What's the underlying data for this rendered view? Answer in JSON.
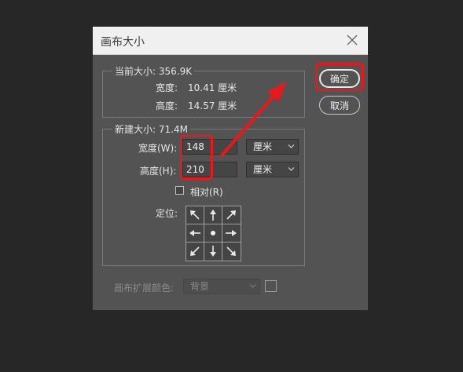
{
  "dialog": {
    "title": "画布大小",
    "current_size": {
      "legend": "当前大小: 356.9K",
      "width_label": "宽度:",
      "width_value": "10.41 厘米",
      "height_label": "高度:",
      "height_value": "14.57 厘米"
    },
    "new_size": {
      "legend": "新建大小: 71.4M",
      "width_label": "宽度(W):",
      "width_value": "148",
      "width_unit": "厘米",
      "height_label": "高度(H):",
      "height_value": "210",
      "height_unit": "厘米",
      "relative_label": "相对(R)",
      "relative_checked": false,
      "anchor_label": "定位:"
    },
    "extension_color": {
      "label": "画布扩展颜色:",
      "value": "背景"
    },
    "buttons": {
      "ok": "确定",
      "cancel": "取消"
    }
  },
  "colors": {
    "dialog_bg": "#535353",
    "titlebar_bg": "#f0f0f0",
    "highlight": "#e8191c",
    "screen_bg": "#272727"
  }
}
